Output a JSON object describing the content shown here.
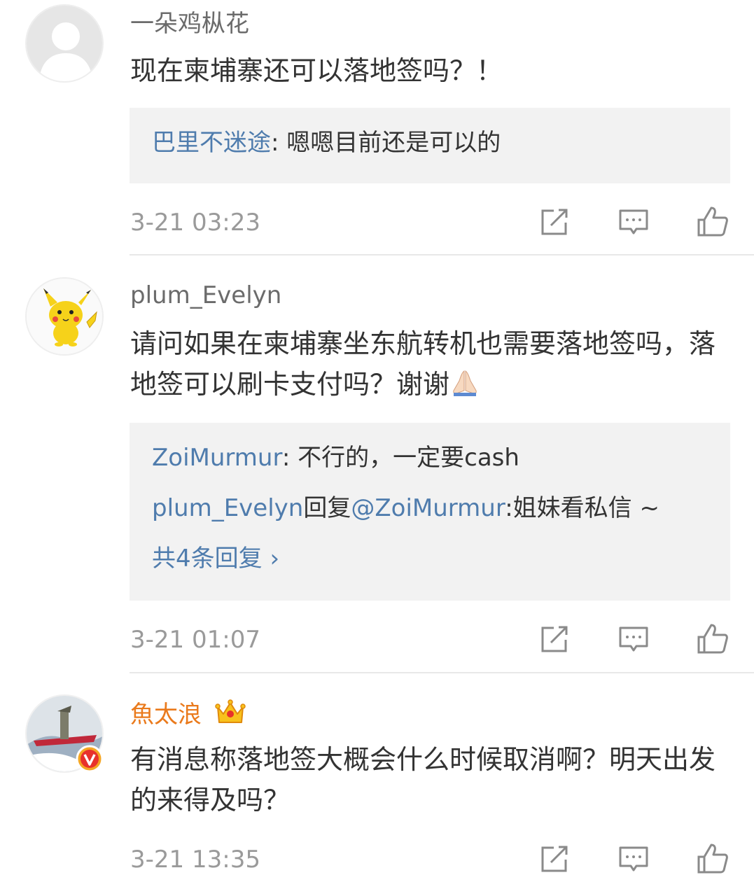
{
  "comments": [
    {
      "username": "一朵鸡枞花",
      "text": "现在柬埔寨还可以落地签吗？！",
      "replies": [
        {
          "user": "巴里不迷途",
          "sep": ": ",
          "text": "嗯嗯目前还是可以的"
        }
      ],
      "time": "3-21 03:23",
      "actions": {
        "share": "share-icon",
        "comment": "comment-icon",
        "like": "like-icon"
      }
    },
    {
      "username": "plum_Evelyn",
      "text": "请问如果在柬埔寨坐东航转机也需要落地签吗，落地签可以刷卡支付吗？谢谢",
      "emoji": "pray-emoji",
      "replies": [
        {
          "user": "ZoiMurmur",
          "sep": ": ",
          "text": "不行的，一定要cash"
        },
        {
          "user": "plum_Evelyn",
          "mid": "回复",
          "mention": "@ZoiMurmur",
          "sep": ":",
          "text": "姐妹看私信 ~"
        }
      ],
      "more_replies": "共4条回复 ›",
      "time": "3-21 01:07",
      "actions": {
        "share": "share-icon",
        "comment": "comment-icon",
        "like": "like-icon"
      }
    },
    {
      "username": "魚太浪",
      "badge": "crown-icon",
      "verified": "verified-v-badge",
      "text": "有消息称落地签大概会什么时候取消啊？明天出发的来得及吗？",
      "time": "3-21 13:35",
      "actions": {
        "share": "share-icon",
        "comment": "comment-icon",
        "like": "like-icon"
      }
    }
  ],
  "colors": {
    "link": "#4f7cad",
    "vip_name": "#ea7a1c",
    "reply_bg": "#f2f2f2",
    "meta_text": "#9a9a9a"
  }
}
